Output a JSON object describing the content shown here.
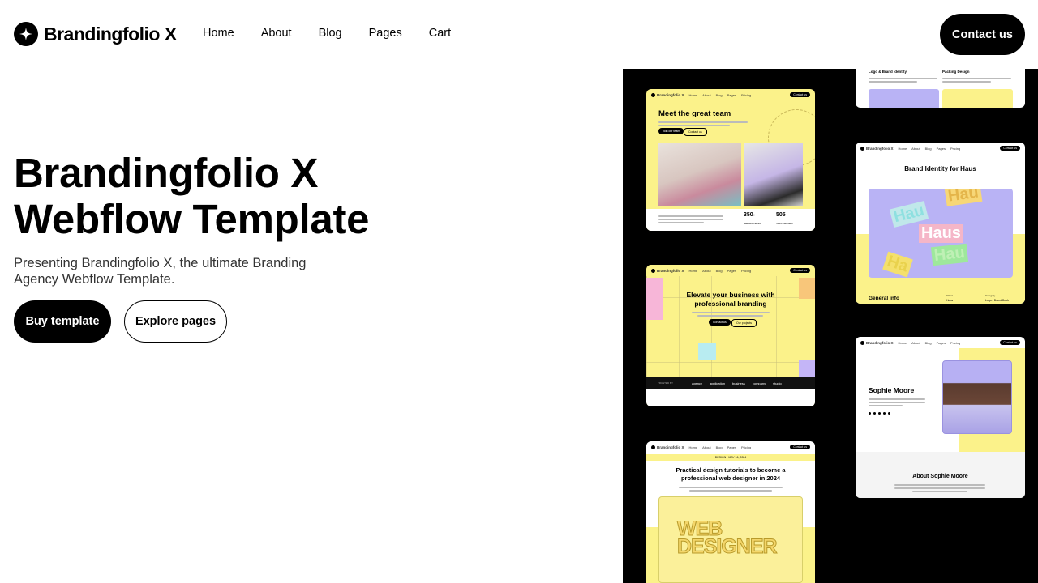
{
  "brand": {
    "name": "Brandingfolio X"
  },
  "nav": {
    "items": [
      "Home",
      "About",
      "Blog",
      "Pages",
      "Cart"
    ]
  },
  "header": {
    "contact_label": "Contact us"
  },
  "hero": {
    "title_line1": "Brandingfolio X",
    "title_line2": "Webflow Template",
    "subtitle": "Presenting Brandingfolio X, the ultimate Branding Agency Webflow Template.",
    "buy_label": "Buy template",
    "explore_label": "Explore pages"
  },
  "showcase": {
    "card_team": {
      "brand": "Brandingfolio X",
      "nav": [
        "Home",
        "About",
        "Blog",
        "Pages",
        "Pricing"
      ],
      "button": "Contact us",
      "heading": "Meet the great team",
      "primary_btn": "Join our team",
      "secondary_btn": "Contact us",
      "stat1_value": "350",
      "stat1_suffix": "+",
      "stat1_label": "Satisfied clients",
      "stat2_value": "505",
      "stat2_label": "Team members"
    },
    "card_services": {
      "service1": "Logo & Brand Identity",
      "service2": "Packing Design"
    },
    "card_haus": {
      "brand": "Brandingfolio X",
      "nav": [
        "Home",
        "About",
        "Blog",
        "Pages",
        "Pricing"
      ],
      "button": "Contact us",
      "heading": "Brand Identity for Haus",
      "label_main": "Haus",
      "label_a": "Hau",
      "label_b": "Hau",
      "label_c": "Hau",
      "label_d": "Ha",
      "footer_title": "General info",
      "footer_col1_label": "Client",
      "footer_col1_value": "Haus",
      "footer_col2_label": "Category",
      "footer_col2_value": "Logo / Brand Book"
    },
    "card_elevate": {
      "brand": "Brandingfolio X",
      "nav": [
        "Home",
        "About",
        "Blog",
        "Pages",
        "Pricing"
      ],
      "button": "Contact us",
      "heading": "Elevate your business with professional branding",
      "primary_btn": "Contact us",
      "secondary_btn": "Our projects",
      "trusted_label": "TRUSTED BY",
      "logos": [
        "agency",
        "application",
        "business",
        "company",
        "studio"
      ]
    },
    "card_sophie": {
      "brand": "Brandingfolio X",
      "nav": [
        "Home",
        "About",
        "Blog",
        "Pages",
        "Pricing"
      ],
      "button": "Contact us",
      "name": "Sophie Moore",
      "about_title": "About Sophie Moore"
    },
    "card_blog": {
      "brand": "Brandingfolio X",
      "nav": [
        "Home",
        "About",
        "Blog",
        "Pages",
        "Pricing"
      ],
      "button": "Contact us",
      "meta": "DESIGN · MAY 16, 2024",
      "heading": "Practical design tutorials to become a professional web designer in 2024",
      "art_line1": "WEB",
      "art_line2": "DESIGNER"
    }
  },
  "colors": {
    "accent_yellow": "#fbf28a",
    "lavender": "#b9b3f5",
    "black": "#000000"
  }
}
